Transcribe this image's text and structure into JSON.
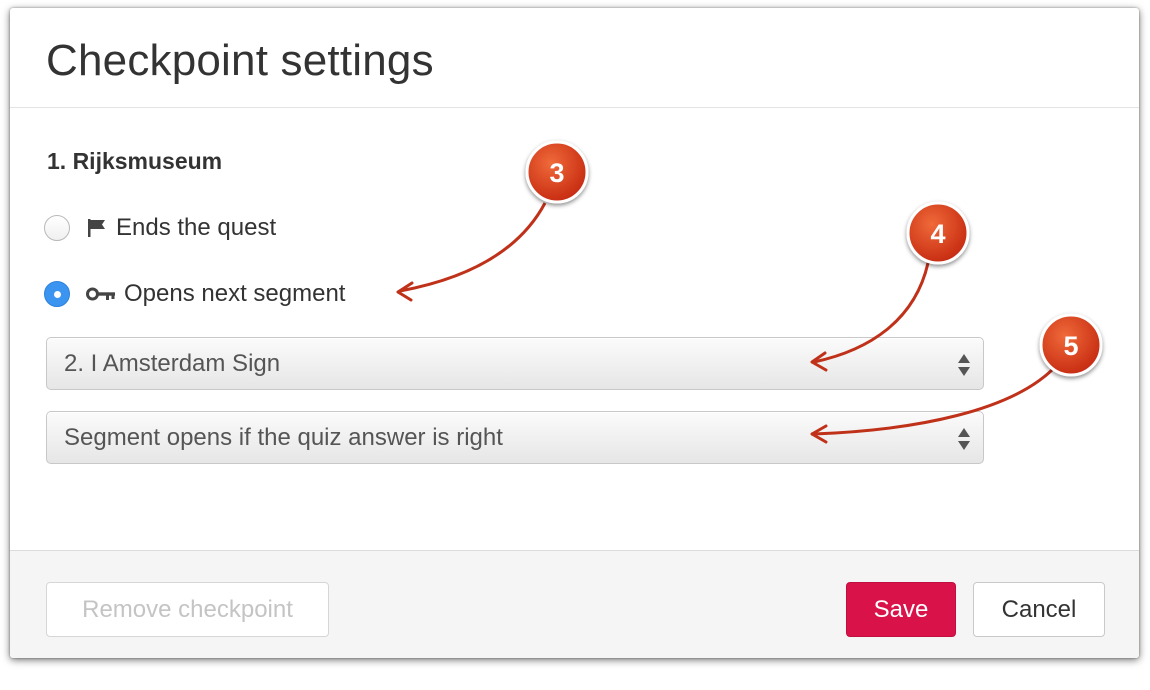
{
  "modal": {
    "title": "Checkpoint settings",
    "checkpoint_name": "1. Rijksmuseum",
    "options": [
      {
        "label": "Ends the quest",
        "icon": "flag-icon",
        "checked": false
      },
      {
        "label": "Opens next segment",
        "icon": "key-icon",
        "checked": true
      }
    ],
    "segment_select": {
      "value": "2. I Amsterdam Sign"
    },
    "condition_select": {
      "value": "Segment opens if the quiz answer is right"
    },
    "footer": {
      "remove_label": "Remove checkpoint",
      "save_label": "Save",
      "cancel_label": "Cancel"
    }
  },
  "annotations": {
    "badges": [
      "3",
      "4",
      "5"
    ],
    "badge_color": "#d43a1a",
    "arrow_color": "#c0311a"
  },
  "colors": {
    "radio_checked": "#3a94f0",
    "save_button": "#d9134a"
  }
}
